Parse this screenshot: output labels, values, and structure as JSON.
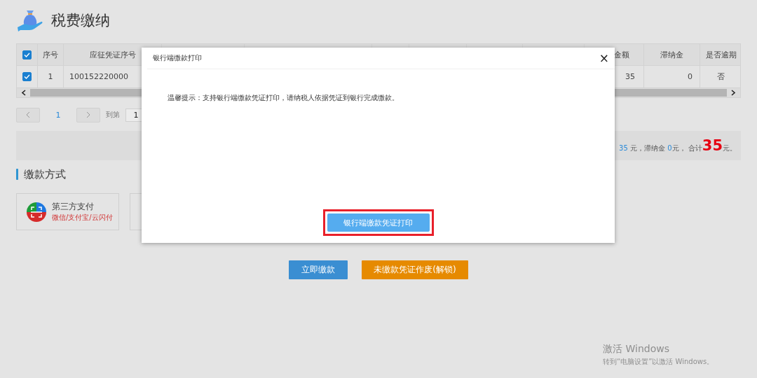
{
  "page": {
    "title": "税费缴纳"
  },
  "table": {
    "select_all": {
      "checked": true
    },
    "columns": [
      {
        "kind": "text",
        "label": "序号"
      },
      {
        "kind": "text",
        "label": "应征凭证序号"
      },
      {
        "kind": "covered"
      },
      {
        "kind": "covered"
      },
      {
        "kind": "covered"
      },
      {
        "kind": "covered"
      },
      {
        "kind": "covered"
      },
      {
        "kind": "covered"
      },
      {
        "kind": "text",
        "label": "金额"
      },
      {
        "kind": "text",
        "label": "滞纳金"
      },
      {
        "kind": "text",
        "label": "是否逾期"
      }
    ],
    "rows": [
      {
        "checked": true,
        "cells": [
          "1",
          "100152220000",
          null,
          null,
          null,
          null,
          null,
          null,
          "35",
          "0",
          "否"
        ]
      }
    ]
  },
  "pagination": {
    "pages": [
      {
        "label": "1",
        "selected": true
      }
    ],
    "goto_label": "到第",
    "goto_value": "1"
  },
  "summary": [
    {
      "kind": "amount",
      "text": "35"
    },
    {
      "kind": "plain",
      "text": " 元，滞纳金 "
    },
    {
      "kind": "amount",
      "text": "0"
    },
    {
      "kind": "plain",
      "text": "元， 合计"
    },
    {
      "kind": "total",
      "text": "35"
    },
    {
      "kind": "plain",
      "text": "元。"
    }
  ],
  "payment": {
    "heading": "缴款方式",
    "methods": [
      {
        "kind": "third_party",
        "title": "第三方支付",
        "subtitle": "微信/支付宝/云闪付"
      },
      {
        "kind": "covered"
      }
    ]
  },
  "actions": [
    {
      "kind": "primary",
      "label": "立即缴款"
    },
    {
      "kind": "warning",
      "label": "未缴款凭证作废(解锁)"
    }
  ],
  "dialog": {
    "title": "银行端缴款打印",
    "close": "×",
    "message": "温馨提示：支持银行端缴款凭证打印，请纳税人依据凭证到银行完成缴款。",
    "button": "银行端缴款凭证打印",
    "highlighted": true
  },
  "os_notice": {
    "title": "激活 Windows",
    "text": "转到“电脑设置”以激活 Windows。"
  }
}
